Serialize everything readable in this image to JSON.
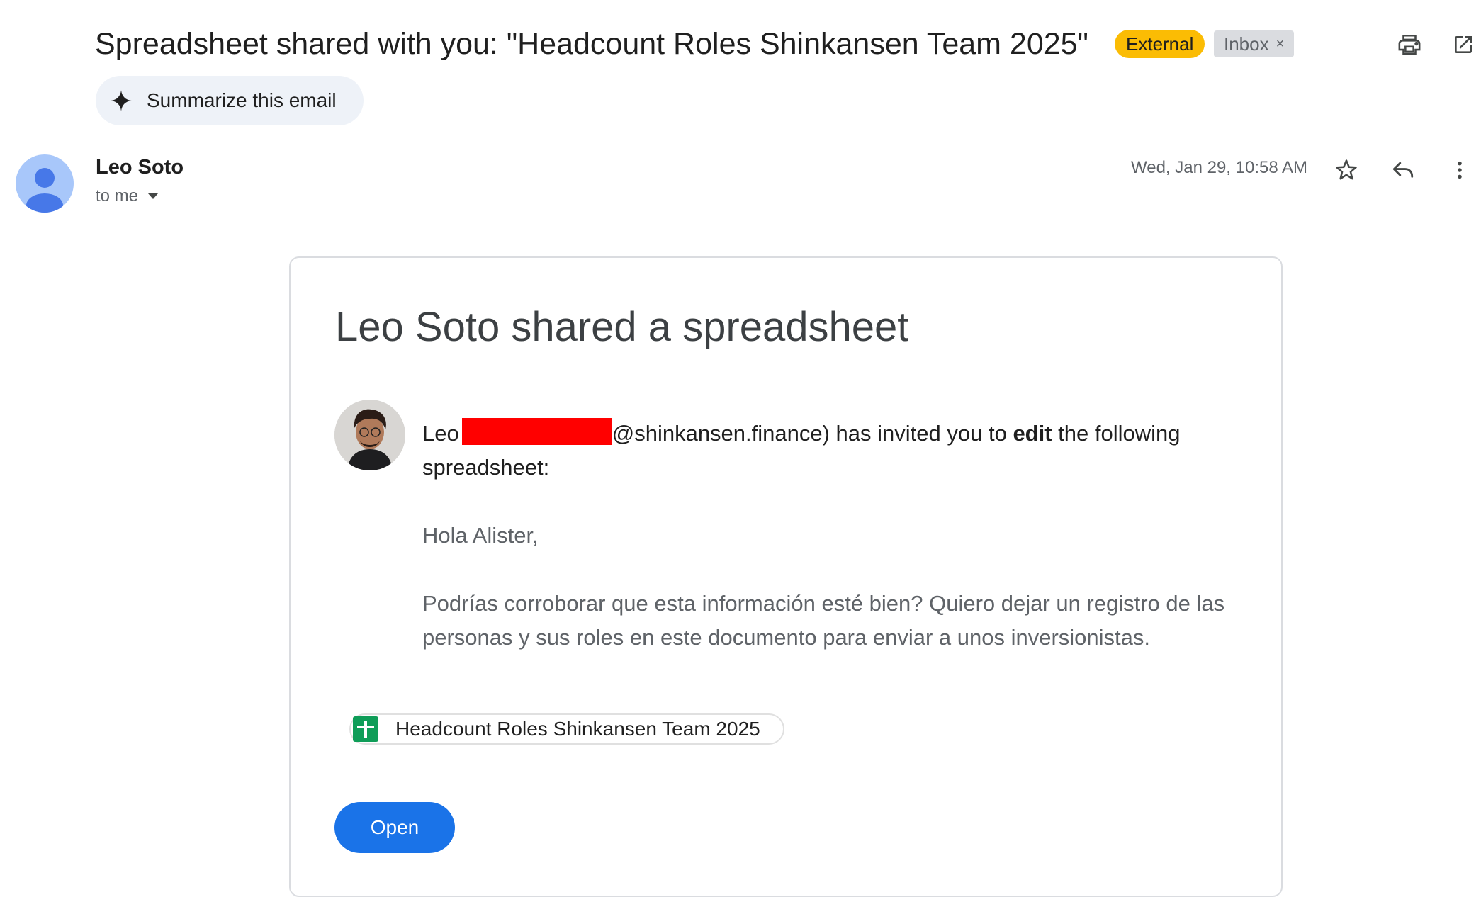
{
  "email": {
    "subject": "Spreadsheet shared with you: \"Headcount Roles Shinkansen Team 2025\"",
    "labels": {
      "external": "External",
      "inbox": "Inbox",
      "inbox_remove": "×"
    },
    "summarize_label": "Summarize this email",
    "sender_name": "Leo Soto",
    "recipient_line": "to me",
    "date": "Wed, Jan 29, 10:58 AM"
  },
  "card": {
    "title": "Leo Soto shared a spreadsheet",
    "invite_prefix": "Leo",
    "invite_domain": "@shinkansen.finance) has invited you to ",
    "invite_bold": "edit",
    "invite_suffix": " the following spreadsheet:",
    "greeting": "Hola Alister,",
    "message": "Podrías corroborar que esta información esté bien? Quiero dejar un registro de las personas y sus roles en este documento para enviar a unos inversionistas.",
    "file_name": "Headcount Roles Shinkansen Team 2025",
    "open_label": "Open"
  },
  "icons": {
    "print": "print-icon",
    "open_new_window": "open-in-new-icon",
    "sparkle": "sparkle-icon",
    "star": "star-icon",
    "reply": "reply-icon",
    "more": "more-vert-icon",
    "dropdown": "arrow-drop-down-icon",
    "sheets": "google-sheets-icon"
  },
  "colors": {
    "external_badge": "#fbbc04",
    "open_button": "#1a73e8",
    "redaction": "#ff0000",
    "sheets_green": "#0f9d58"
  }
}
